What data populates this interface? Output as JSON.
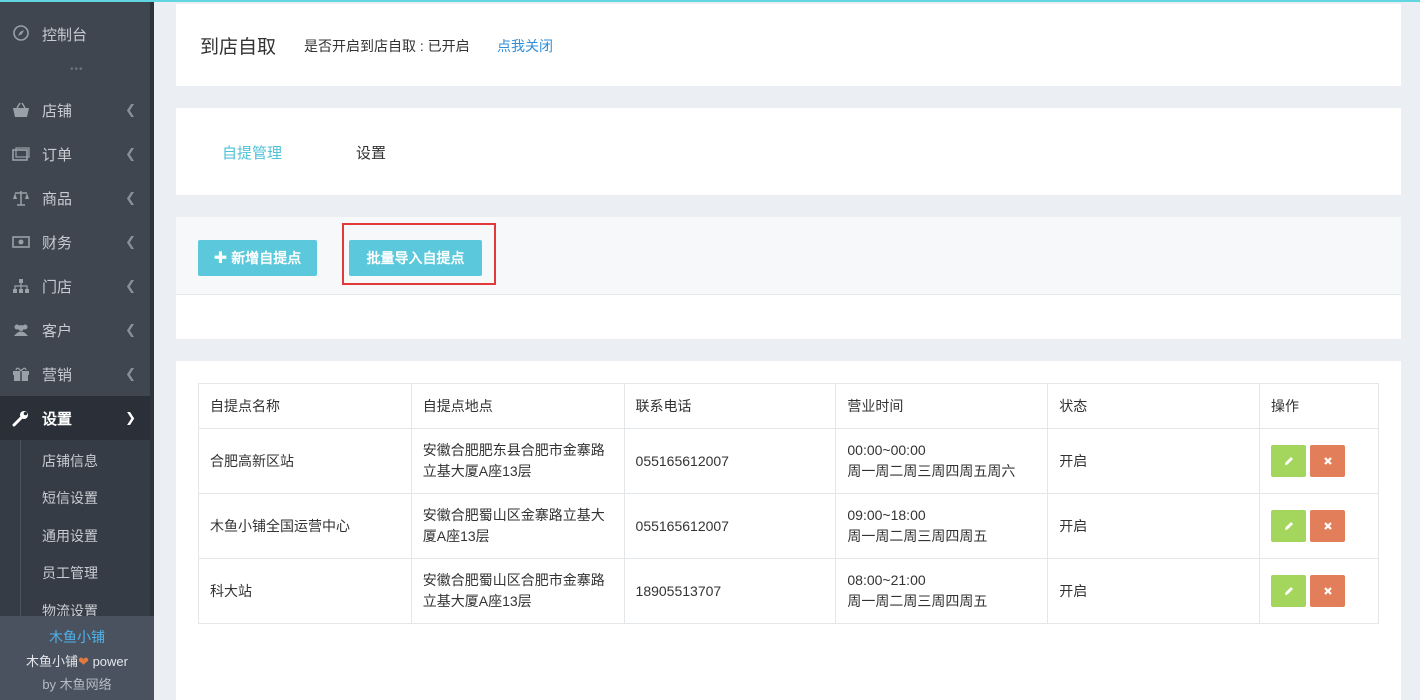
{
  "sidebar": {
    "dashboard": "控制台",
    "dots": "•••",
    "items": [
      {
        "label": "店铺",
        "icon": "basket-icon"
      },
      {
        "label": "订单",
        "icon": "order-icon"
      },
      {
        "label": "商品",
        "icon": "scale-icon"
      },
      {
        "label": "财务",
        "icon": "money-icon"
      },
      {
        "label": "门店",
        "icon": "sitemap-icon"
      },
      {
        "label": "客户",
        "icon": "users-icon"
      },
      {
        "label": "营销",
        "icon": "gift-icon"
      },
      {
        "label": "设置",
        "icon": "wrench-icon"
      }
    ],
    "sub_items": [
      "店铺信息",
      "短信设置",
      "通用设置",
      "员工管理",
      "物流设置"
    ],
    "footer": {
      "brand": "木鱼小铺",
      "line2_a": "木鱼小铺",
      "line2_b": "power",
      "line3": "by 木鱼网络"
    }
  },
  "header": {
    "title": "到店自取",
    "status": "是否开启到店自取 : 已开启",
    "toggle_link": "点我关闭"
  },
  "tabs": [
    "自提管理",
    "设置"
  ],
  "toolbar": {
    "add_label": "新增自提点",
    "import_label": "批量导入自提点"
  },
  "table": {
    "headers": [
      "自提点名称",
      "自提点地点",
      "联系电话",
      "营业时间",
      "状态",
      "操作"
    ],
    "rows": [
      {
        "name": "合肥高新区站",
        "address": "安徽合肥肥东县合肥市金寨路立基大厦A座13层",
        "phone": "055165612007",
        "hours": "00:00~00:00",
        "days": "周一周二周三周四周五周六",
        "status": "开启"
      },
      {
        "name": "木鱼小铺全国运营中心",
        "address": "安徽合肥蜀山区金寨路立基大厦A座13层",
        "phone": "055165612007",
        "hours": "09:00~18:00",
        "days": "周一周二周三周四周五",
        "status": "开启"
      },
      {
        "name": "科大站",
        "address": "安徽合肥蜀山区合肥市金寨路立基大厦A座13层",
        "phone": "18905513707",
        "hours": "08:00~21:00",
        "days": "周一周二周三周四周五",
        "status": "开启"
      }
    ]
  },
  "colors": {
    "accent": "#5bc8db",
    "sidebar_bg": "#3f4650",
    "highlight_box": "#e23a3a",
    "edit": "#a4d65e",
    "delete": "#e27e5a"
  }
}
